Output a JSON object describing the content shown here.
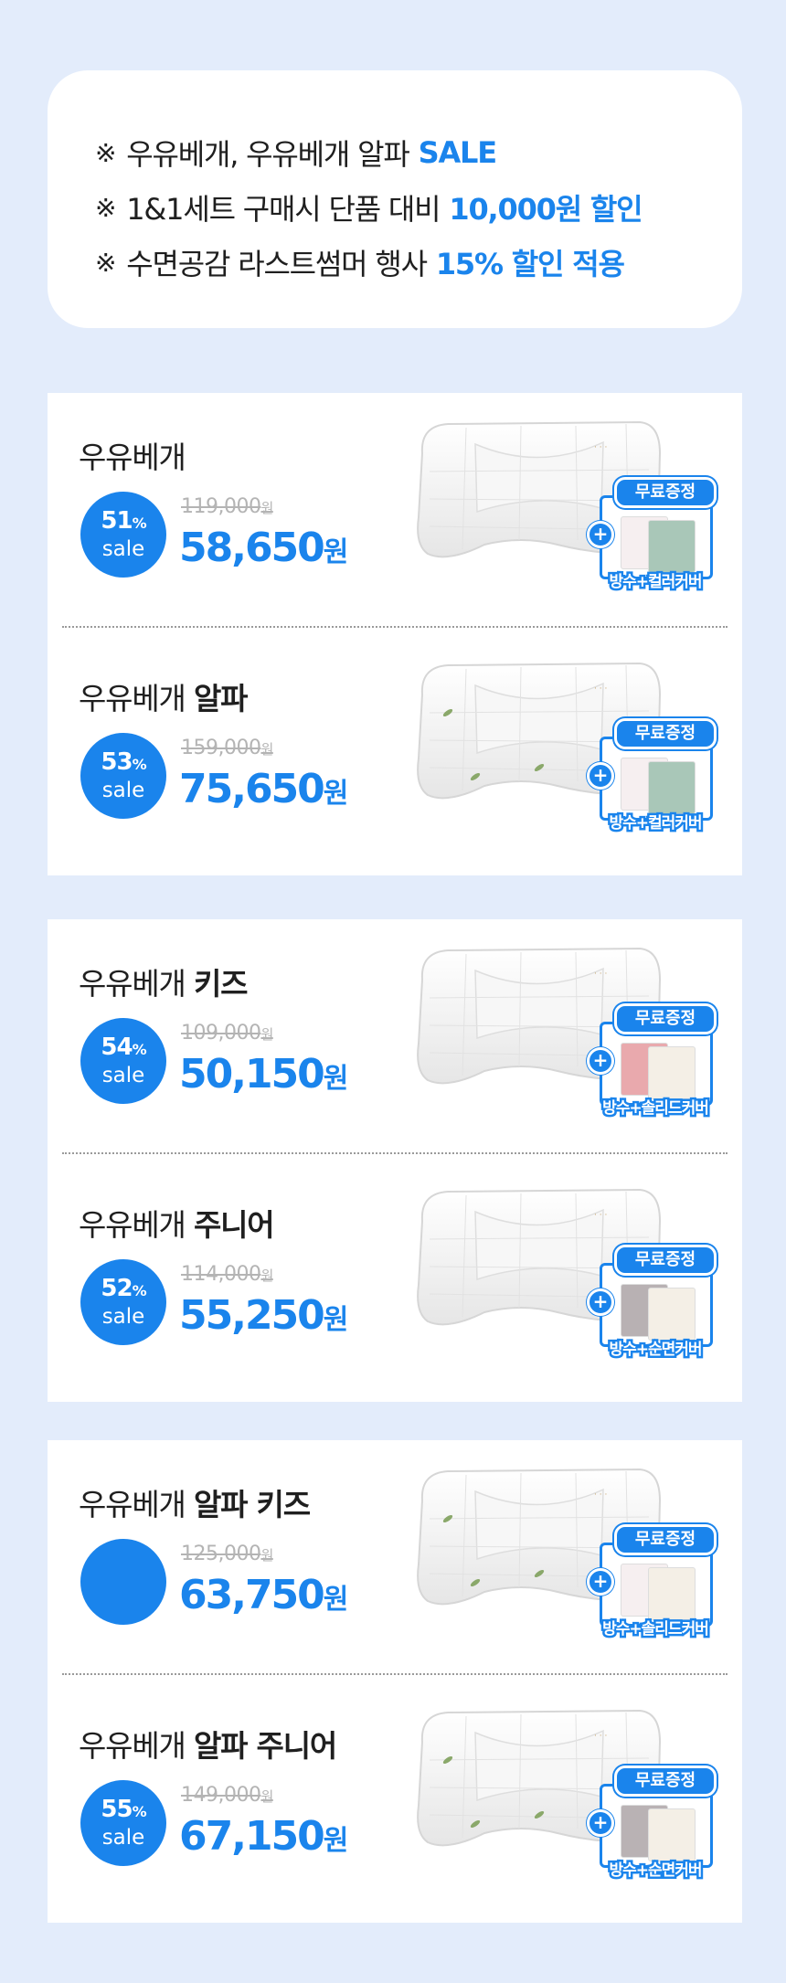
{
  "notice": {
    "mark": "※",
    "lines": [
      {
        "text": "우유베개, 우유베개 알파",
        "highlight": "SALE"
      },
      {
        "text": "1&1세트 구매시 단품 대비",
        "highlight": "10,000원 할인"
      },
      {
        "text": "수면공감 라스트썸머 행사",
        "highlight": "15% 할인 적용"
      }
    ]
  },
  "colors": {
    "accent": "#1a84ec",
    "background": "#e3ecfb",
    "strike": "#b4b4b4"
  },
  "gift_label": "무료증정",
  "badge_sale": "sale",
  "won": "원",
  "groups": [
    {
      "products": [
        {
          "name": "우유베개",
          "name_bold": "",
          "discount": "51",
          "original": "119,000",
          "price": "58,650",
          "gift": "방수+컬러커버",
          "pillow_icon": "quilted-pillow-icon",
          "gift_colors": [
            "#f6eff0",
            "#a9c7b8"
          ]
        },
        {
          "name": "우유베개",
          "name_bold": "알파",
          "discount": "53",
          "original": "159,000",
          "price": "75,650",
          "gift": "방수+컬러커버",
          "pillow_icon": "leaf-quilted-pillow-icon",
          "gift_colors": [
            "#f6eff0",
            "#a9c7b8"
          ]
        }
      ]
    },
    {
      "products": [
        {
          "name": "우유베개",
          "name_bold": "키즈",
          "discount": "54",
          "original": "109,000",
          "price": "50,150",
          "gift": "방수+솔리드커버",
          "pillow_icon": "kids-pillow-icon",
          "gift_colors": [
            "#e9a9ad",
            "#f4efe6"
          ]
        },
        {
          "name": "우유베개",
          "name_bold": "주니어",
          "discount": "52",
          "original": "114,000",
          "price": "55,250",
          "gift": "방수+순면커버",
          "pillow_icon": "junior-pillow-icon",
          "gift_colors": [
            "#b8b1b3",
            "#f4efe6"
          ]
        }
      ]
    },
    {
      "products": [
        {
          "name": "우유베개",
          "name_bold": "알파 키즈",
          "discount": "",
          "original": "125,000",
          "price": "63,750",
          "gift": "방수+솔리드커버",
          "pillow_icon": "alpha-kids-pillow-icon",
          "gift_colors": [
            "#f6eff0",
            "#f4efe6"
          ]
        },
        {
          "name": "우유베개",
          "name_bold": "알파 주니어",
          "discount": "55",
          "original": "149,000",
          "price": "67,150",
          "gift": "방수+순면커버",
          "pillow_icon": "alpha-junior-pillow-icon",
          "gift_colors": [
            "#b9b2b4",
            "#f4efe6"
          ]
        }
      ]
    }
  ]
}
